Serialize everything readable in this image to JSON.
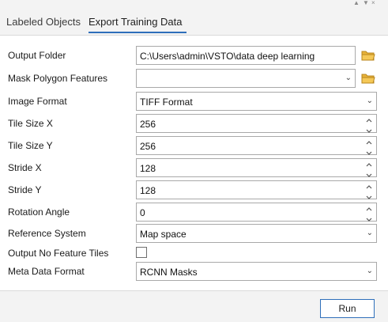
{
  "window": {
    "controls": [
      "▲",
      "▼",
      "×"
    ]
  },
  "tabs": [
    {
      "label": "Labeled Objects",
      "active": false
    },
    {
      "label": "Export Training Data",
      "active": true
    }
  ],
  "form": {
    "output_folder": {
      "label": "Output Folder",
      "value": "C:\\Users\\admin\\VSTO\\data deep learning"
    },
    "mask_polygon": {
      "label": "Mask Polygon Features",
      "value": ""
    },
    "image_format": {
      "label": "Image Format",
      "value": "TIFF Format"
    },
    "tile_size_x": {
      "label": "Tile Size X",
      "value": "256"
    },
    "tile_size_y": {
      "label": "Tile Size Y",
      "value": "256"
    },
    "stride_x": {
      "label": "Stride X",
      "value": "128"
    },
    "stride_y": {
      "label": "Stride Y",
      "value": "128"
    },
    "rotation_angle": {
      "label": "Rotation Angle",
      "value": "0"
    },
    "reference_system": {
      "label": "Reference System",
      "value": "Map space"
    },
    "output_no_feature": {
      "label": "Output No Feature Tiles",
      "checked": false
    },
    "metadata_format": {
      "label": "Meta Data Format",
      "value": "RCNN Masks"
    }
  },
  "actions": {
    "run_label": "Run"
  },
  "colors": {
    "accent": "#2f6fba",
    "folder": "#e8b33a",
    "panel_bg": "#ffffff",
    "chrome_bg": "#f3f3f3"
  }
}
